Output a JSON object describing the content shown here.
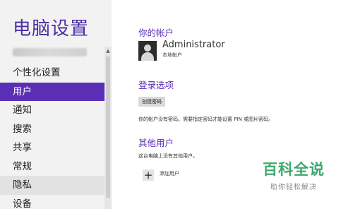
{
  "sidebar": {
    "title": "电脑设置",
    "items": [
      {
        "label": "个性化设置"
      },
      {
        "label": "用户"
      },
      {
        "label": "通知"
      },
      {
        "label": "搜索"
      },
      {
        "label": "共享"
      },
      {
        "label": "常规"
      },
      {
        "label": "隐私"
      },
      {
        "label": "设备"
      }
    ],
    "active_index": 1
  },
  "main": {
    "account": {
      "heading": "你的帐户",
      "user_name": "Administrator",
      "user_type": "本地帐户",
      "avatar_icon": "user-avatar-icon"
    },
    "signin": {
      "heading": "登录选项",
      "create_password_label": "创建密码",
      "note": "你的帐户没有密码。需要指定密码才能设置 PIN 或图片密码。"
    },
    "others": {
      "heading": "其他用户",
      "note": "这台电脑上没有其他用户。",
      "add_icon": "plus-icon",
      "add_label": "添加用户"
    }
  },
  "watermark": {
    "main": "百科全说",
    "sub": "助你轻松解决"
  },
  "colors": {
    "accent": "#5b2fb5",
    "sidebar_bg": "#f2f2f2",
    "watermark": "#3ea86e"
  }
}
